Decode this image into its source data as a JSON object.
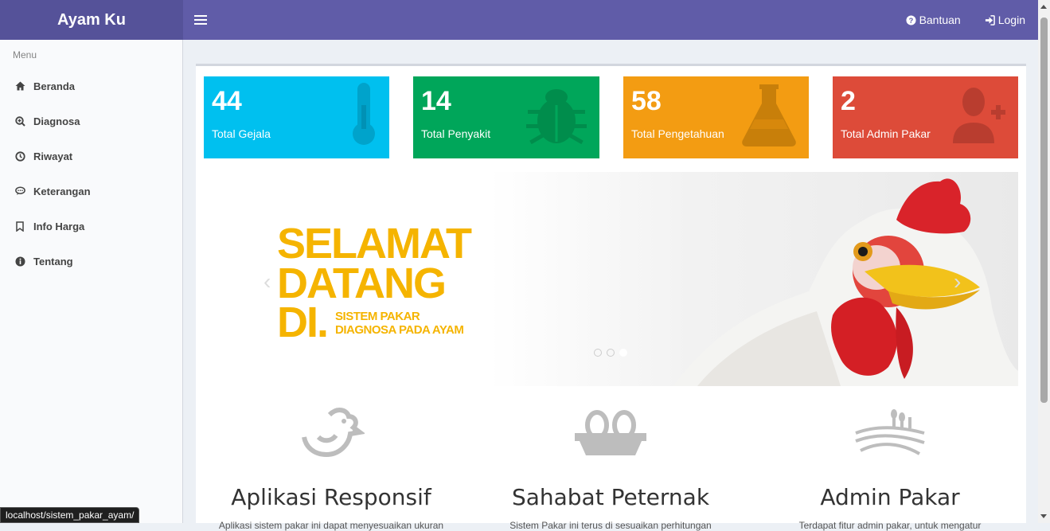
{
  "app": {
    "title": "Ayam Ku"
  },
  "nav": {
    "help_label": "Bantuan",
    "login_label": "Login"
  },
  "sidebar": {
    "header": "Menu",
    "items": [
      {
        "label": "Beranda",
        "icon": "home-icon"
      },
      {
        "label": "Diagnosa",
        "icon": "search-plus-icon"
      },
      {
        "label": "Riwayat",
        "icon": "history-icon"
      },
      {
        "label": "Keterangan",
        "icon": "comment-icon"
      },
      {
        "label": "Info Harga",
        "icon": "bookmark-icon"
      },
      {
        "label": "Tentang",
        "icon": "info-icon"
      }
    ]
  },
  "stats": [
    {
      "value": "44",
      "label": "Total Gejala",
      "color": "#00c0ef",
      "icon": "thermometer-icon"
    },
    {
      "value": "14",
      "label": "Total Penyakit",
      "color": "#00a65a",
      "icon": "bug-icon"
    },
    {
      "value": "58",
      "label": "Total Pengetahuan",
      "color": "#f39c12",
      "icon": "flask-icon"
    },
    {
      "value": "2",
      "label": "Total Admin Pakar",
      "color": "#dd4b39",
      "icon": "user-plus-icon"
    }
  ],
  "slider": {
    "line1": "SELAMAT",
    "line2": "DATANG",
    "line3": "DI.",
    "sub1": "SISTEM PAKAR",
    "sub2": "DIAGNOSA  PADA AYAM",
    "accent": "#f5b400"
  },
  "features": [
    {
      "title": "Aplikasi Responsif",
      "desc": "Aplikasi sistem pakar ini dapat menyesuaikan ukuran",
      "icon": "chicken-icon"
    },
    {
      "title": "Sahabat Peternak",
      "desc": "Sistem Pakar ini terus di sesuaikan perhitungan",
      "icon": "egg-tray-icon"
    },
    {
      "title": "Admin Pakar",
      "desc": "Terdapat fitur admin pakar, untuk mengatur",
      "icon": "farm-icon"
    }
  ],
  "status_url": "localhost/sistem_pakar_ayam/"
}
